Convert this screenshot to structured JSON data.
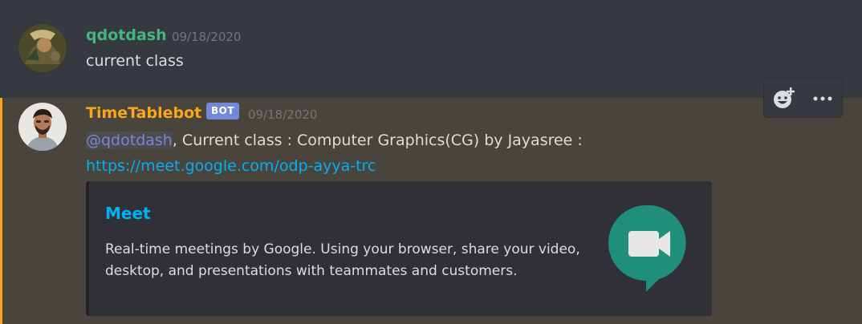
{
  "messages": [
    {
      "author": "qdotdash",
      "author_color": "#43b581",
      "timestamp": "09/18/2020",
      "content": "current class",
      "avatar_icon": "fantasy-character-avatar"
    },
    {
      "author": "TimeTablebot",
      "author_color": "#faa61a",
      "bot_tag": "BOT",
      "timestamp": "09/18/2020",
      "mention": "@qdotdash",
      "content_rest": ", Current class : Computer Graphics(CG) by Jayasree :",
      "link": "https://meet.google.com/odp-ayya-trc",
      "avatar_icon": "person-photo-avatar",
      "embed": {
        "title": "Meet",
        "description": "Real-time meetings by Google. Using your browser, share your video, desktop, and presentations with teammates and customers.",
        "thumbnail_icon": "google-meet-logo",
        "title_color": "#00b0f4"
      }
    }
  ],
  "toolbar": {
    "add_reaction_icon": "add-reaction-icon",
    "more_icon": "more-options-icon"
  }
}
